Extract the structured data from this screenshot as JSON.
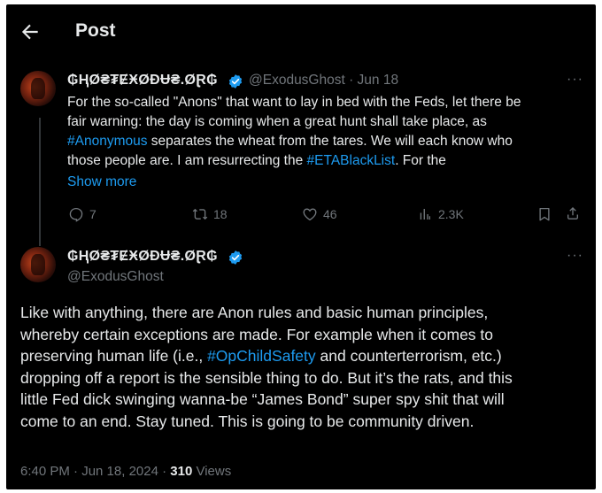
{
  "header": {
    "title": "Post"
  },
  "reply": {
    "display_name": "₲ⱧØ₴₮ɆӾØĐɄ₴.ØⱤ₲",
    "handle_date": "@ExodusGhost · Jun 18",
    "more": "···",
    "text": {
      "l1": "For the so-called \"Anons\" that want to lay in bed with the Feds, let there be",
      "l2": "fair warning: the day is coming when a great hunt shall take place, as",
      "l3_tag": "#Anonymous",
      "l3_rest": " separates the wheat from the tares. We will each know who",
      "l4_pre": "those people are. I am resurrecting the ",
      "l4_tag": "#ETABlackList",
      "l4_rest": ". For the"
    },
    "show_more": "Show more",
    "stats": {
      "replies": "7",
      "reposts": "18",
      "likes": "46",
      "views": "2.3K"
    }
  },
  "main": {
    "display_name": "₲ⱧØ₴₮ɆӾØĐɄ₴.ØⱤ₲",
    "handle": "@ExodusGhost",
    "more": "···",
    "text": {
      "l1": "Like with anything, there are Anon rules and basic human principles,",
      "l2": "whereby certain exceptions are made. For example when it comes to",
      "l3_pre": "preserving human life (i.e., ",
      "l3_tag": "#OpChildSafety",
      "l3_rest": " and counterterrorism, etc.)",
      "l4": "dropping off a report is the sensible thing to do. But it’s the rats, and this",
      "l5": "little Fed dick swinging wanna-be “James Bond” super spy shit that will",
      "l6": "come to an end. Stay tuned. This is going to be community driven."
    },
    "timestamp": "6:40 PM · Jun 18, 2024 · ",
    "views_count": "310",
    "views_label": " Views"
  },
  "colors": {
    "background": "#000000",
    "accent": "#1d9bf0",
    "muted": "#71767b",
    "text": "#e7e9ea"
  }
}
